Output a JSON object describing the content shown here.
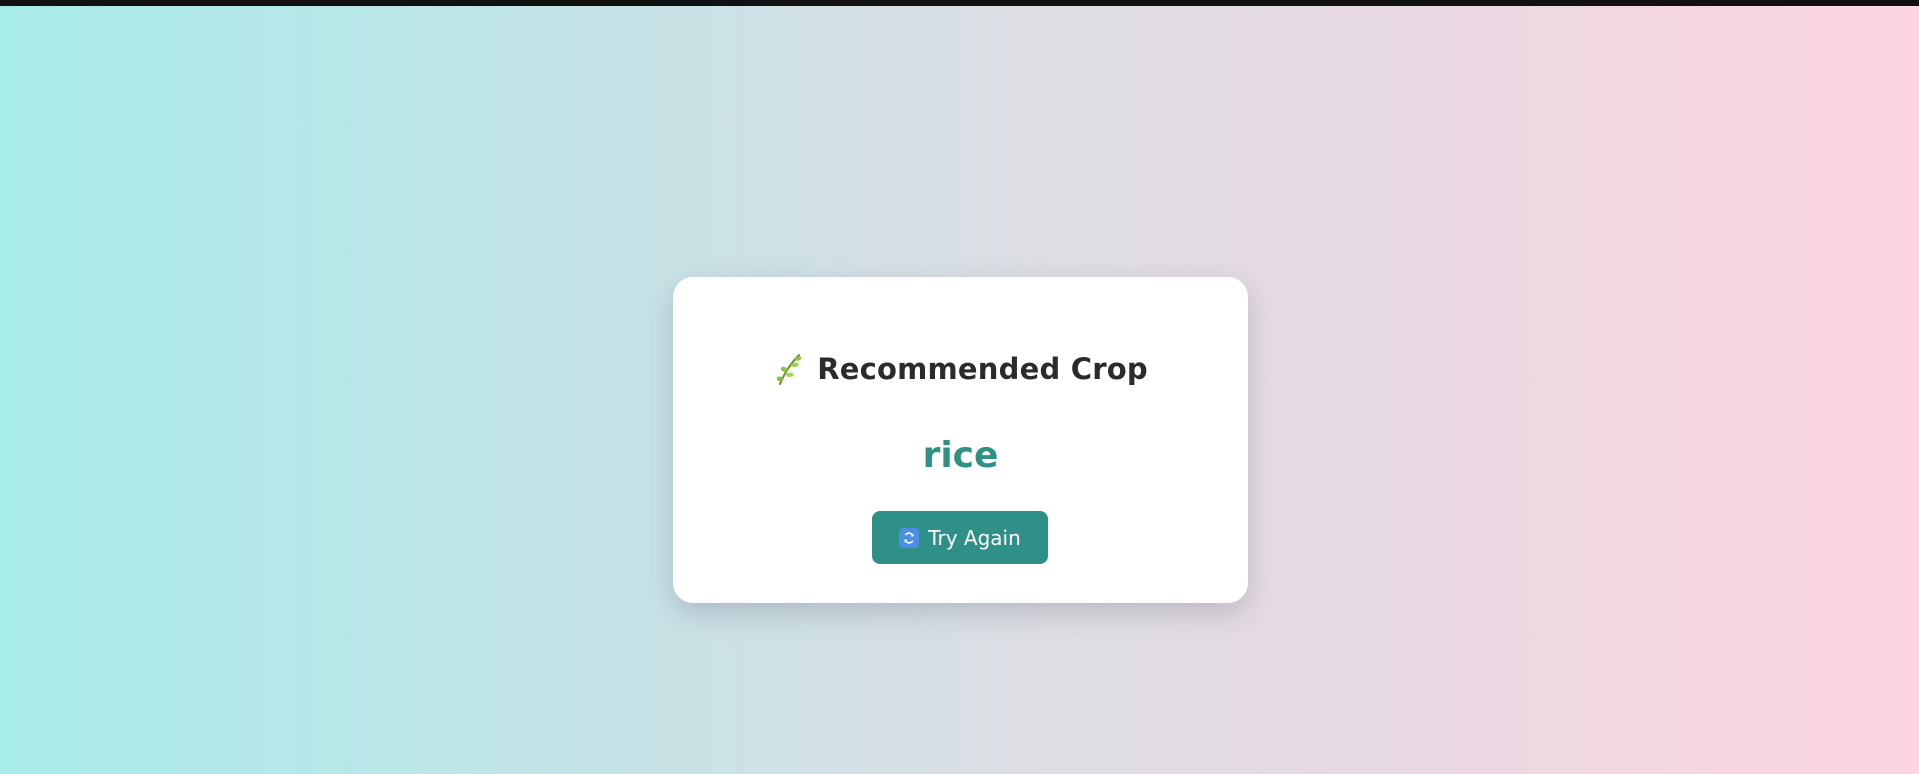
{
  "result": {
    "heading": "Recommended Crop",
    "crop": "rice"
  },
  "actions": {
    "try_again_label": "Try Again"
  },
  "icons": {
    "heading_icon": "leaf-icon",
    "button_icon": "refresh-icon"
  },
  "colors": {
    "accent": "#2e9086",
    "crop_text": "#2f9184",
    "heading_text": "#2b2b2b",
    "card": "#ffffff"
  }
}
